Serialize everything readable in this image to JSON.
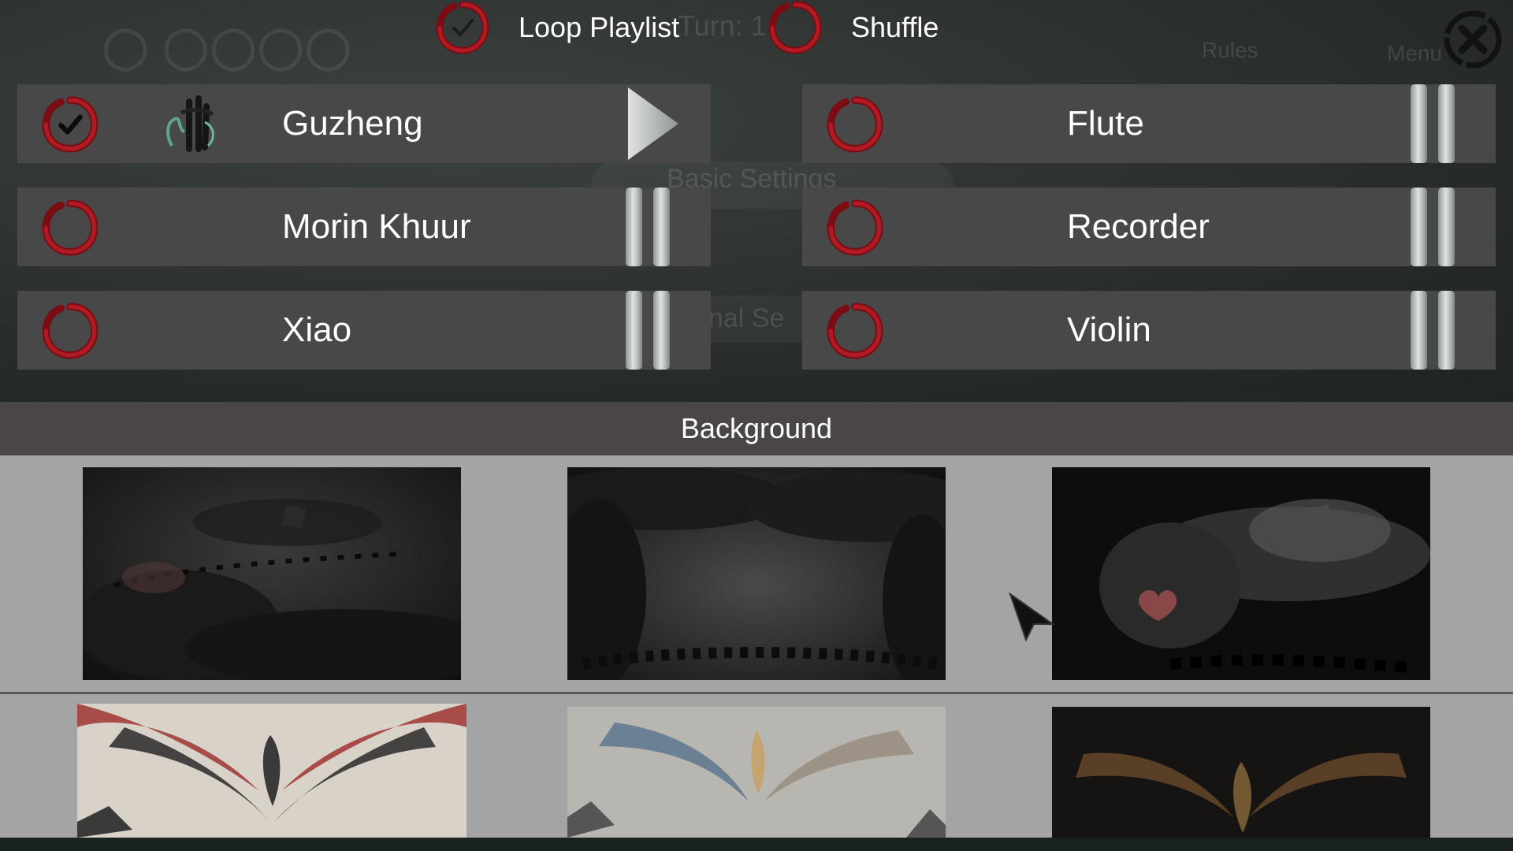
{
  "background_screen": {
    "turn_text": "Turn: 1",
    "rules_label": "Rules",
    "menu_label": "Menu",
    "basic_settings_label": "Basic Settings",
    "personal_settings_label": "onal Se"
  },
  "toolbar": {
    "loop_playlist_label": "Loop Playlist",
    "loop_playlist_checked": true,
    "shuffle_label": "Shuffle",
    "shuffle_checked": false,
    "close_icon": "close-icon"
  },
  "playlist": {
    "tracks": [
      {
        "name": "Guzheng",
        "selected": true,
        "state": "stopped",
        "control_icon": "play-icon",
        "thumbnail_icon": "guzheng-icon"
      },
      {
        "name": "Flute",
        "selected": false,
        "state": "paused",
        "control_icon": "pause-icon"
      },
      {
        "name": "Morin Khuur",
        "selected": false,
        "state": "paused",
        "control_icon": "pause-icon"
      },
      {
        "name": "Recorder",
        "selected": false,
        "state": "paused",
        "control_icon": "pause-icon"
      },
      {
        "name": "Xiao",
        "selected": false,
        "state": "paused",
        "control_icon": "pause-icon"
      },
      {
        "name": "Violin",
        "selected": false,
        "state": "paused",
        "control_icon": "pause-icon"
      }
    ]
  },
  "background_section": {
    "title": "Background",
    "options": [
      {
        "id": "ink-dice-landscape",
        "theme": "dark"
      },
      {
        "id": "ink-clouds-void",
        "theme": "dark"
      },
      {
        "id": "ink-heart-storm",
        "theme": "dark"
      },
      {
        "id": "red-phoenix",
        "theme": "light"
      },
      {
        "id": "blue-phoenix",
        "theme": "light"
      },
      {
        "id": "golden-phoenix",
        "theme": "dark"
      }
    ]
  },
  "colors": {
    "panel_bg": "#484848",
    "accent_red": "#a3141c",
    "section_header": "#4a4645",
    "gallery_bg": "#a4a4a4"
  }
}
